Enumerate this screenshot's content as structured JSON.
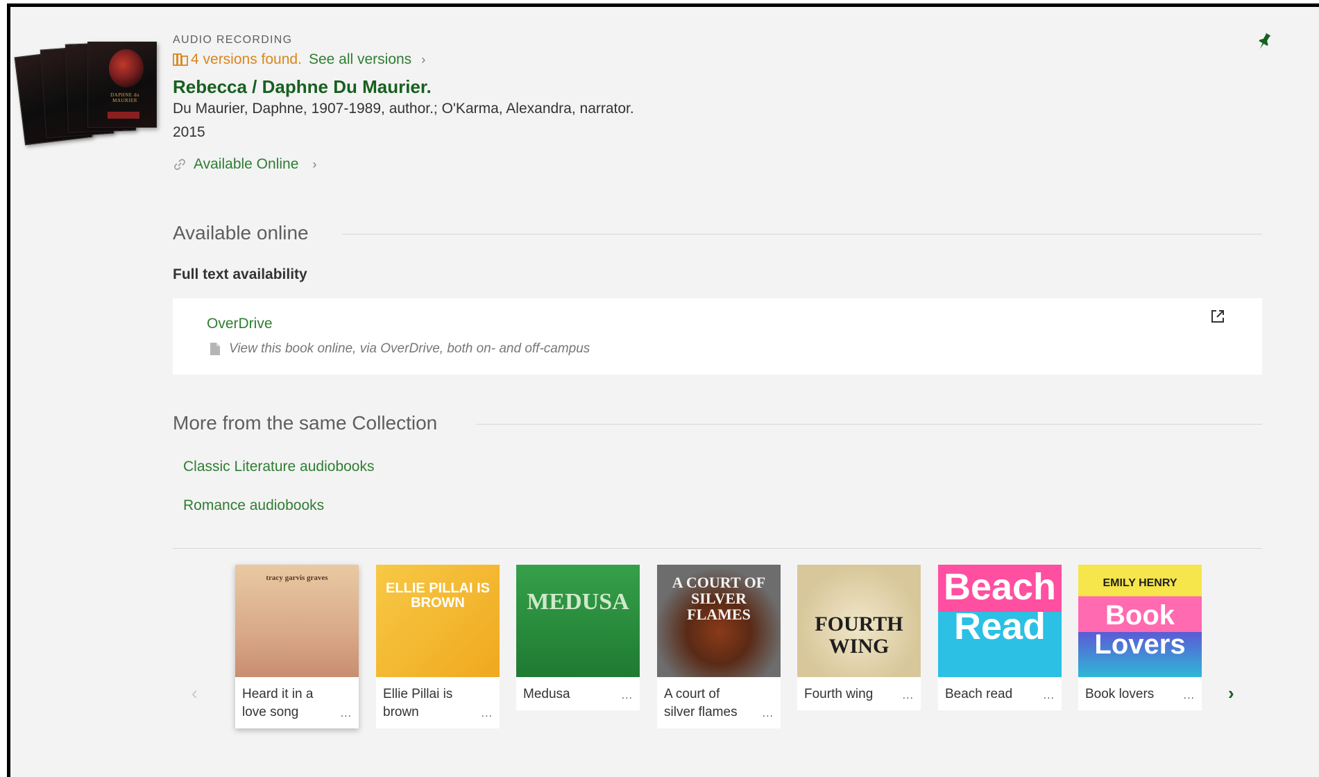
{
  "record": {
    "type": "AUDIO RECORDING",
    "versions_found": "4 versions found.",
    "see_all_versions": "See all versions",
    "title": "Rebecca / Daphne Du Maurier.",
    "authors": "Du Maurier, Daphne, 1907-1989, author.; O'Karma, Alexandra, narrator.",
    "year": "2015",
    "available_online_link": "Available Online",
    "thumbnail_text": "DAPHNE du MAURIER"
  },
  "available_online": {
    "heading": "Available online",
    "full_text_label": "Full text availability",
    "provider": "OverDrive",
    "description": "View this book online, via OverDrive, both on- and off-campus"
  },
  "collection": {
    "heading": "More from the same Collection",
    "links": [
      "Classic Literature audiobooks",
      "Romance audiobooks"
    ]
  },
  "carousel": {
    "items": [
      {
        "line1": "Heard it in a",
        "line2": "love song",
        "cover_text": "tracy garvis graves",
        "cover_color": "#e8c39a"
      },
      {
        "line1": "Ellie Pillai is",
        "line2": "brown",
        "cover_text": "ELLIE PILLAI IS BROWN",
        "cover_color": "#f2b632"
      },
      {
        "line1": "Medusa",
        "line2": "",
        "cover_text": "MEDUSA",
        "cover_color": "#2e8b3e"
      },
      {
        "line1": "A court of",
        "line2": "silver flames",
        "cover_text": "A COURT OF SILVER FLAMES",
        "cover_color": "#7a7a7a"
      },
      {
        "line1": "Fourth wing",
        "line2": "",
        "cover_text": "FOURTH WING",
        "cover_color": "#e3d7b6"
      },
      {
        "line1": "Beach read",
        "line2": "",
        "cover_text": "Beach Read",
        "cover_color": "#3cc1d9"
      },
      {
        "line1": "Book lovers",
        "line2": "",
        "cover_text": "Book Lovers",
        "cover_color": "#f5e34a",
        "cover_author": "EMILY HENRY"
      }
    ],
    "more": "..."
  },
  "colors": {
    "accent_green": "#2f7d32",
    "title_green": "#17601f",
    "versions_orange": "#d9861d",
    "background": "#f3f3f3"
  },
  "icons": [
    "versions-icon",
    "chevron-right-icon",
    "link-icon",
    "pin-icon",
    "external-link-icon",
    "document-icon",
    "carousel-prev-icon",
    "carousel-next-icon"
  ]
}
